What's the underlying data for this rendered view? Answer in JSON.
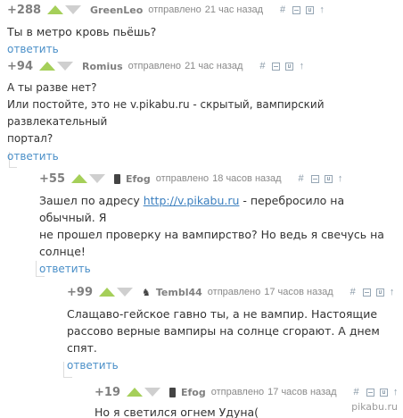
{
  "comments": [
    {
      "rating": "+288",
      "author": "GreenLeo",
      "sent": "отправлено",
      "time": "21 час назад",
      "lines": [
        "Ты в метро кровь пьёшь?"
      ],
      "reply": "ответить",
      "author_icon": null
    },
    {
      "rating": "+94",
      "author": "Romius",
      "sent": "отправлено",
      "time": "21 час назад",
      "lines": [
        "А ты разве нет?",
        "Или постойте, это не v.pikabu.ru - скрытый, вампирский развлекательный",
        "портал?"
      ],
      "reply": "ответить",
      "author_icon": null
    },
    {
      "rating": "+55",
      "author": "Efog",
      "sent": "отправлено",
      "time": "18 часов назад",
      "line1_before": "Зашел по адресу ",
      "link": "http://v.pikabu.ru",
      "line1_after": " - перебросило на обычный. Я",
      "lines": [
        "не прошел проверку на вампирство? Но ведь я свечусь на",
        "солнце!"
      ],
      "reply": "ответить",
      "author_icon": "phone-icon"
    },
    {
      "rating": "+99",
      "author": "Tembl44",
      "sent": "отправлено",
      "time": "17 часов назад",
      "lines": [
        "Слащаво-гейское гавно ты, а не вампир. Настоящие",
        "рассово верные вампиры на солнце сгорают. А днем спят."
      ],
      "reply": "ответить",
      "author_icon": "cat-icon"
    },
    {
      "rating": "+19",
      "author": "Efog",
      "sent": "отправлено",
      "time": "17 часов назад",
      "lines": [
        "Но я светился огнем Удуна("
      ],
      "author_icon": "phone-icon"
    }
  ],
  "tools": {
    "hash": "#",
    "up": "↑"
  },
  "watermark": "pikabu.ru"
}
